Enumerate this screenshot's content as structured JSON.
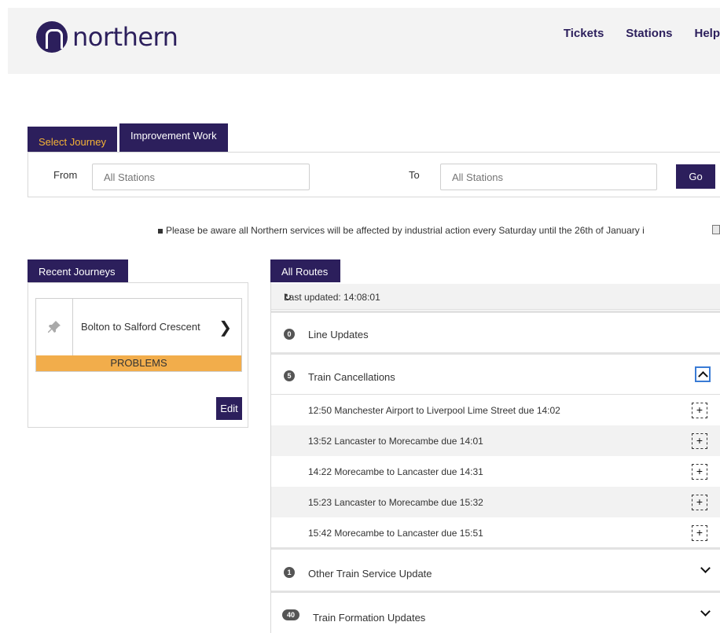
{
  "header": {
    "logo_text": "northern",
    "nav": [
      "Tickets",
      "Stations",
      "Help"
    ]
  },
  "journey": {
    "tabs": [
      "Select Journey",
      "Improvement Work"
    ],
    "from_label": "From",
    "from_placeholder": "All Stations",
    "to_label": "To",
    "to_placeholder": "All Stations",
    "go_label": "Go"
  },
  "notice": "Please be aware all Northern services will be affected by industrial action every Saturday until the 26th of January i",
  "recent": {
    "tab": "Recent Journeys",
    "journey_title": "Bolton to Salford Crescent",
    "status": "PROBLEMS",
    "edit_label": "Edit"
  },
  "routes": {
    "tab": "All Routes",
    "last_updated": "Last updated: 14:08:01",
    "sections": [
      {
        "count": "0",
        "title": "Line Updates"
      },
      {
        "count": "5",
        "title": "Train Cancellations"
      },
      {
        "count": "1",
        "title": "Other Train Service Update"
      },
      {
        "count": "40",
        "title": "Train Formation Updates"
      }
    ],
    "cancellations": [
      "12:50 Manchester Airport to Liverpool Lime Street due 14:02",
      "13:52 Lancaster to Morecambe due 14:01",
      "14:22 Morecambe to Lancaster due 14:31",
      "15:23 Lancaster to Morecambe due 15:32",
      "15:42 Morecambe to Lancaster due 15:51"
    ]
  },
  "colors": {
    "brand": "#2c1f5c",
    "accent": "#f5b335",
    "problems": "#f2ad4b"
  },
  "icons": [
    "pin-icon",
    "chevron-right-icon",
    "refresh-icon",
    "chevron-up-icon",
    "chevron-down-icon",
    "plus-icon",
    "pause-icon"
  ]
}
